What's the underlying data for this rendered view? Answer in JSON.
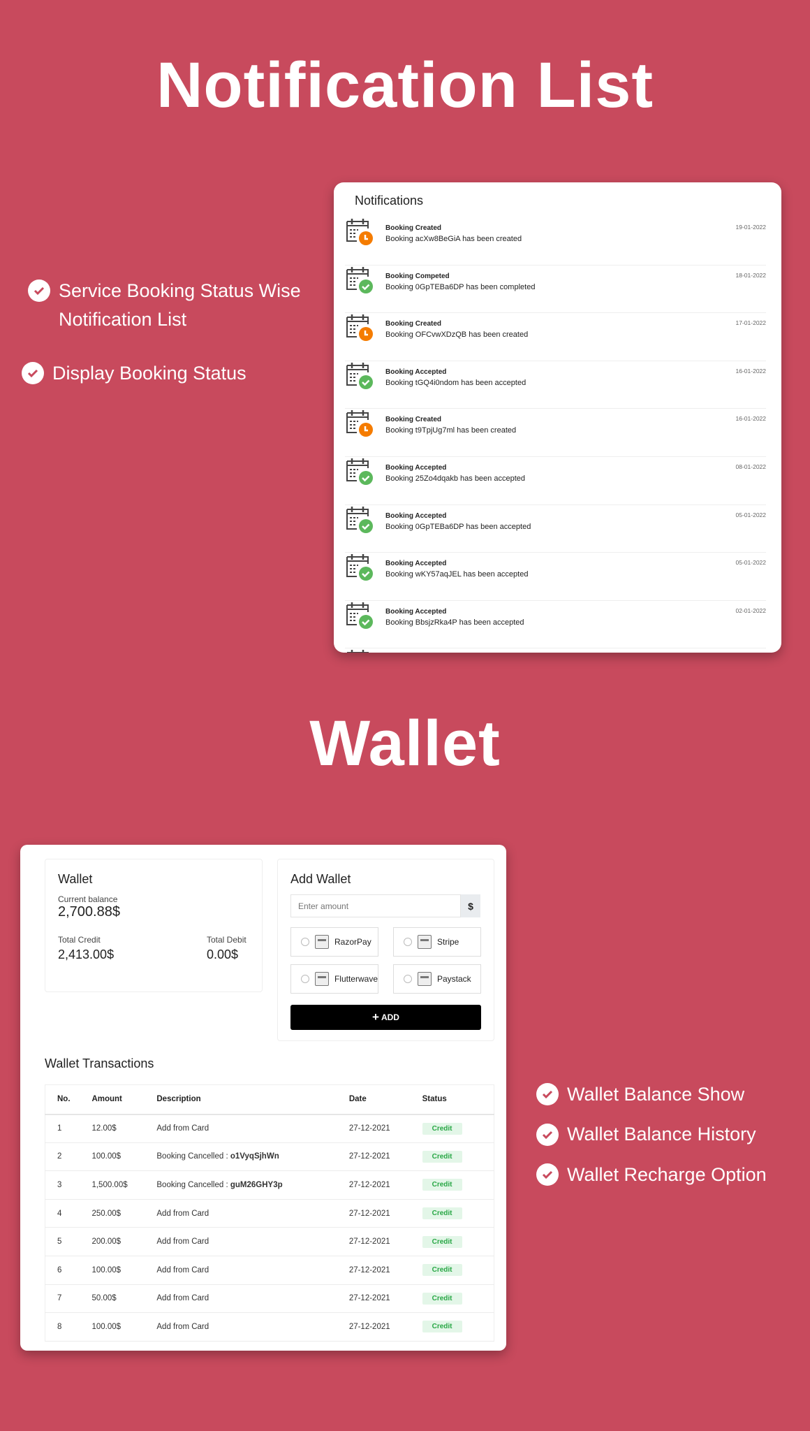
{
  "sections": {
    "notification_title": "Notification List",
    "wallet_title": "Wallet"
  },
  "left_features": [
    "Service Booking Status Wise",
    "Notification List",
    "Display Booking Status"
  ],
  "right_features": [
    "Wallet Balance Show",
    "Wallet Balance History",
    "Wallet Recharge Option"
  ],
  "colors": {
    "background": "#c84a5d",
    "created_badge": "#f57c00",
    "accepted_badge": "#5cb85c",
    "credit_text": "#28a745"
  },
  "notifications": {
    "title": "Notifications",
    "items": [
      {
        "type": "created",
        "title": "Booking Created",
        "message": "Booking acXw8BeGiA has been created",
        "date": "19-01-2022"
      },
      {
        "type": "completed",
        "title": "Booking Competed",
        "message": "Booking 0GpTEBa6DP has been completed",
        "date": "18-01-2022"
      },
      {
        "type": "created",
        "title": "Booking Created",
        "message": "Booking OFCvwXDzQB has been created",
        "date": "17-01-2022"
      },
      {
        "type": "accepted",
        "title": "Booking Accepted",
        "message": "Booking tGQ4i0ndom has been accepted",
        "date": "16-01-2022"
      },
      {
        "type": "created",
        "title": "Booking Created",
        "message": "Booking t9TpjUg7ml has been created",
        "date": "16-01-2022"
      },
      {
        "type": "accepted",
        "title": "Booking Accepted",
        "message": "Booking 25Zo4dqakb has been accepted",
        "date": "08-01-2022"
      },
      {
        "type": "accepted",
        "title": "Booking Accepted",
        "message": "Booking 0GpTEBa6DP has been accepted",
        "date": "05-01-2022"
      },
      {
        "type": "accepted",
        "title": "Booking Accepted",
        "message": "Booking wKY57aqJEL has been accepted",
        "date": "05-01-2022"
      },
      {
        "type": "accepted",
        "title": "Booking Accepted",
        "message": "Booking BbsjzRka4P has been accepted",
        "date": "02-01-2022"
      }
    ]
  },
  "wallet": {
    "title": "Wallet",
    "current_balance_label": "Current balance",
    "current_balance": "2,700.88$",
    "total_credit_label": "Total Credit",
    "total_credit": "2,413.00$",
    "total_debit_label": "Total Debit",
    "total_debit": "0.00$"
  },
  "add_wallet": {
    "title": "Add Wallet",
    "amount_placeholder": "Enter amount",
    "currency": "$",
    "gateways": [
      "RazorPay",
      "Stripe",
      "Flutterwave",
      "Paystack"
    ],
    "add_label": "ADD"
  },
  "transactions": {
    "title": "Wallet Transactions",
    "columns": [
      "No.",
      "Amount",
      "Description",
      "Date",
      "Status"
    ],
    "rows": [
      {
        "no": "1",
        "amount": "12.00$",
        "desc": "Add from Card",
        "ref": "",
        "date": "27-12-2021",
        "status": "Credit"
      },
      {
        "no": "2",
        "amount": "100.00$",
        "desc": "Booking Cancelled : ",
        "ref": "o1VyqSjhWn",
        "date": "27-12-2021",
        "status": "Credit"
      },
      {
        "no": "3",
        "amount": "1,500.00$",
        "desc": "Booking Cancelled : ",
        "ref": "guM26GHY3p",
        "date": "27-12-2021",
        "status": "Credit"
      },
      {
        "no": "4",
        "amount": "250.00$",
        "desc": "Add from Card",
        "ref": "",
        "date": "27-12-2021",
        "status": "Credit"
      },
      {
        "no": "5",
        "amount": "200.00$",
        "desc": "Add from Card",
        "ref": "",
        "date": "27-12-2021",
        "status": "Credit"
      },
      {
        "no": "6",
        "amount": "100.00$",
        "desc": "Add from Card",
        "ref": "",
        "date": "27-12-2021",
        "status": "Credit"
      },
      {
        "no": "7",
        "amount": "50.00$",
        "desc": "Add from Card",
        "ref": "",
        "date": "27-12-2021",
        "status": "Credit"
      },
      {
        "no": "8",
        "amount": "100.00$",
        "desc": "Add from Card",
        "ref": "",
        "date": "27-12-2021",
        "status": "Credit"
      }
    ]
  }
}
